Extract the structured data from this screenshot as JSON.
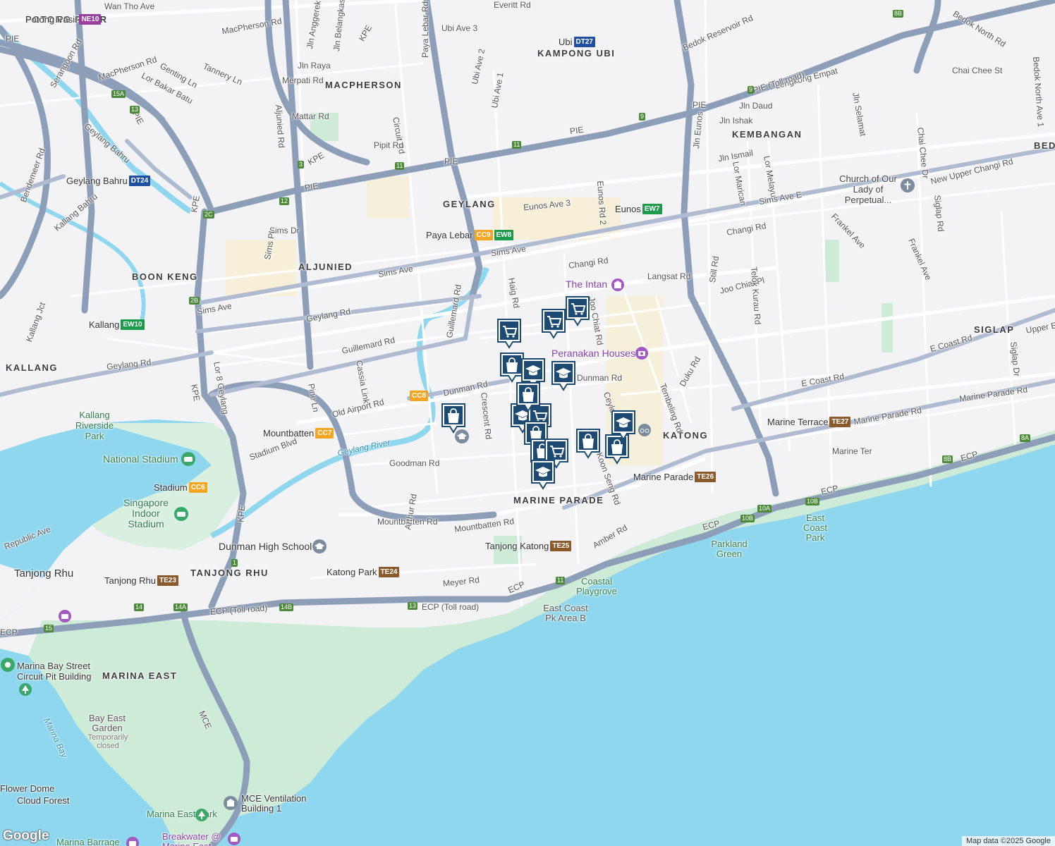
{
  "attribution": "Map data ©2025 Google",
  "logo": "Google",
  "colors": {
    "water": "#8fd7ee",
    "park": "#cdebd6",
    "expressway": "#8c9eb8",
    "road": "#ffffff",
    "land": "#f3f3f5",
    "marker": "#1d4a73"
  },
  "areas": [
    "POTONG PASIR",
    "MACPHERSON",
    "KAMPONG UBI",
    "KEMBANGAN",
    "GEYLANG",
    "ALJUNIED",
    "BOON KENG",
    "KALLANG",
    "KATONG",
    "MARINE PARADE",
    "TANJONG RHU",
    "MARINA EAST",
    "SIGLAP",
    "BEDOK"
  ],
  "roads": [
    "MacPherson Rd",
    "Ubi Ave 3",
    "Ubi Ave 2",
    "Ubi Ave 1",
    "Jln Raya",
    "Merpati Rd",
    "Mattar Rd",
    "Circuit Rd",
    "Pipit Rd",
    "Genting Ln",
    "Tannery Ln",
    "Lor Bakar Batu",
    "Serangoon Rd",
    "Geylang Bahru",
    "Bendemeer Rd",
    "Kallang Bahru",
    "Kallang Jct",
    "Sims Dr",
    "Sims Pl",
    "Sims Ave",
    "Aljunied Rd",
    "Paya Lebar Rd",
    "Geylang Rd",
    "Guillemard Rd",
    "Pine Ln",
    "Cassia Link",
    "Old Airport Rd",
    "Dunman Rd",
    "Crescent Rd",
    "Goodman Rd",
    "Mountbatten Rd",
    "Arthur Rd",
    "Meyer Rd",
    "Haig Rd",
    "Changi Rd",
    "Eunos Ave 3",
    "Eunos Rd 2",
    "Langsat Rd",
    "Joo Chiat Pl",
    "Joo Chiat Rd",
    "Still Rd",
    "Telok Kurau Rd",
    "Duku Rd",
    "Tembeling Rd",
    "E Coast Rd",
    "Marine Parade Rd",
    "Marine Ter",
    "Amber Rd",
    "Jln Eunos",
    "Jln Ismail",
    "Lor Marican",
    "Lor Melayu",
    "Jln Ishak",
    "Jln Daud",
    "Lengkong Empat",
    "Jln Selamat",
    "Bedok Reservoir Rd",
    "Bedok North Rd",
    "Bedok North Ave 1",
    "Chai Chee St",
    "Chai Chee Dr",
    "Siglap Rd",
    "Siglap Dr",
    "Frankel Ave",
    "Sims Ave E",
    "New Upper Changi Rd",
    "Upper East Coast Rd",
    "Stadium Blvd",
    "Republic Ave",
    "Lor 8 Geylang",
    "Ceylon Rd",
    "Koon Seng Rd",
    "Jln Anggerek",
    "Jln Belangkas",
    "Wan Tho Ave",
    "Everitt Rd"
  ],
  "expressways": [
    "PIE",
    "PIE (Toll road)",
    "KPE",
    "ECP",
    "ECP (Toll road)",
    "MCE"
  ],
  "water_labels": [
    "Geylang River",
    "Marina Bay"
  ],
  "parks": [
    "Kallang Riverside Park",
    "East Coast Park",
    "Parkland Green",
    "Coastal Playgrove",
    "East Coast Pk Area B",
    "Bay East Garden",
    "Marina East Park"
  ],
  "pois": [
    "National Stadium",
    "Stadium",
    "Singapore Indoor Stadium",
    "Dunman High School",
    "The Intan",
    "Peranakan Houses",
    "Church of Our Lady of Perpetual...",
    "Marina Bay Street Circuit Pit Building",
    "MCE Ventilation Building 1",
    "Flower Dome",
    "Cloud Forest",
    "Marina Barrage",
    "Breakwater @ Marina East",
    "Temporarily closed"
  ],
  "mrt": [
    {
      "name": "Potong Pasir",
      "code": "NE10",
      "color": "#9b3e9e"
    },
    {
      "name": "Ubi",
      "code": "DT27",
      "color": "#1f4fa0"
    },
    {
      "name": "Geylang Bahru",
      "code": "DT24",
      "color": "#1f4fa0"
    },
    {
      "name": "Paya Lebar",
      "code": "CC9",
      "color": "#f4a623"
    },
    {
      "name": "",
      "code": "EW8",
      "color": "#1c9c4b"
    },
    {
      "name": "Eunos",
      "code": "EW7",
      "color": "#1c9c4b"
    },
    {
      "name": "Kallang",
      "code": "EW10",
      "color": "#1c9c4b"
    },
    {
      "name": "",
      "code": "CC8",
      "color": "#f4a623"
    },
    {
      "name": "Mountbatten",
      "code": "CC7",
      "color": "#f4a623"
    },
    {
      "name": "Stadium",
      "code": "CC6",
      "color": "#f4a623"
    },
    {
      "name": "Marine Terrace",
      "code": "TE27",
      "color": "#8b5a2b"
    },
    {
      "name": "Marine Parade",
      "code": "TE26",
      "color": "#8b5a2b"
    },
    {
      "name": "Tanjong Katong",
      "code": "TE25",
      "color": "#8b5a2b"
    },
    {
      "name": "Katong Park",
      "code": "TE24",
      "color": "#8b5a2b"
    },
    {
      "name": "Tanjong Rhu",
      "code": "TE23",
      "color": "#8b5a2b"
    }
  ],
  "markers": [
    {
      "type": "shopping-cart"
    },
    {
      "type": "shopping-cart"
    },
    {
      "type": "shopping-cart"
    },
    {
      "type": "shopping-bag"
    },
    {
      "type": "school"
    },
    {
      "type": "school"
    },
    {
      "type": "shopping-bag"
    },
    {
      "type": "school"
    },
    {
      "type": "shopping-cart"
    },
    {
      "type": "shopping-bag"
    },
    {
      "type": "shopping-bag"
    },
    {
      "type": "shopping-bag"
    },
    {
      "type": "shopping-cart"
    },
    {
      "type": "shopping-bag"
    },
    {
      "type": "shopping-bag"
    },
    {
      "type": "school"
    },
    {
      "type": "school"
    }
  ]
}
